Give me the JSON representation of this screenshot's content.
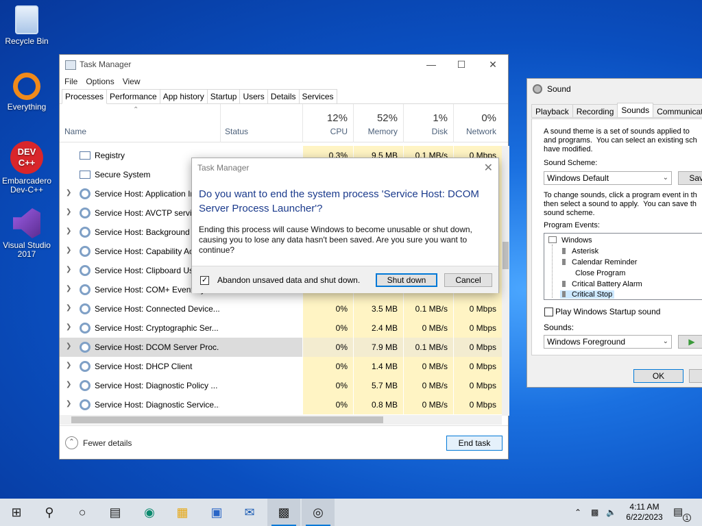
{
  "desktop": {
    "icons": [
      {
        "label": "Recycle Bin"
      },
      {
        "label": "Everything"
      },
      {
        "label": "Embarcadero Dev-C++",
        "badge": "DEV C++"
      },
      {
        "label": "Visual Studio 2017"
      }
    ]
  },
  "taskmanager": {
    "title": "Task Manager",
    "menu": [
      "File",
      "Options",
      "View"
    ],
    "tabs": [
      "Processes",
      "Performance",
      "App history",
      "Startup",
      "Users",
      "Details",
      "Services"
    ],
    "columns": {
      "name": "Name",
      "status": "Status",
      "cpu": {
        "pct": "12%",
        "label": "CPU"
      },
      "memory": {
        "pct": "52%",
        "label": "Memory"
      },
      "disk": {
        "pct": "1%",
        "label": "Disk"
      },
      "network": {
        "pct": "0%",
        "label": "Network"
      }
    },
    "rows": [
      {
        "name": "Registry",
        "cpu": "0.3%",
        "mem": "9.5 MB",
        "disk": "0.1 MB/s",
        "net": "0 Mbps",
        "expandable": false
      },
      {
        "name": "Secure System",
        "cpu": "",
        "mem": "",
        "disk": "",
        "net": "",
        "expandable": false
      },
      {
        "name": "Service Host: Application Information",
        "cpu": "",
        "mem": "",
        "disk": "",
        "net": "",
        "expandable": true
      },
      {
        "name": "Service Host: AVCTP service",
        "cpu": "",
        "mem": "",
        "disk": "",
        "net": "",
        "expandable": true
      },
      {
        "name": "Service Host: Background Intelligent",
        "cpu": "",
        "mem": "",
        "disk": "",
        "net": "",
        "expandable": true
      },
      {
        "name": "Service Host: Capability Access",
        "cpu": "",
        "mem": "",
        "disk": "",
        "net": "",
        "expandable": true
      },
      {
        "name": "Service Host: Clipboard User",
        "cpu": "",
        "mem": "",
        "disk": "",
        "net": "",
        "expandable": true
      },
      {
        "name": "Service Host: COM+ Event System",
        "cpu": "",
        "mem": "",
        "disk": "",
        "net": "",
        "expandable": true
      },
      {
        "name": "Service Host: Connected Device...",
        "cpu": "0%",
        "mem": "3.5 MB",
        "disk": "0.1 MB/s",
        "net": "0 Mbps",
        "expandable": true
      },
      {
        "name": "Service Host: Cryptographic Ser...",
        "cpu": "0%",
        "mem": "2.4 MB",
        "disk": "0 MB/s",
        "net": "0 Mbps",
        "expandable": true
      },
      {
        "name": "Service Host: DCOM Server Proc...",
        "cpu": "0%",
        "mem": "7.9 MB",
        "disk": "0.1 MB/s",
        "net": "0 Mbps",
        "expandable": true,
        "selected": true
      },
      {
        "name": "Service Host: DHCP Client",
        "cpu": "0%",
        "mem": "1.4 MB",
        "disk": "0 MB/s",
        "net": "0 Mbps",
        "expandable": true
      },
      {
        "name": "Service Host: Diagnostic Policy ...",
        "cpu": "0%",
        "mem": "5.7 MB",
        "disk": "0 MB/s",
        "net": "0 Mbps",
        "expandable": true
      },
      {
        "name": "Service Host: Diagnostic Service...",
        "cpu": "0%",
        "mem": "0.8 MB",
        "disk": "0 MB/s",
        "net": "0 Mbps",
        "expandable": true
      }
    ],
    "fewer_details": "Fewer details",
    "end_task": "End task"
  },
  "dialog": {
    "title": "Task Manager",
    "instruction": "Do you want to end the system process 'Service Host: DCOM Server Process Launcher'?",
    "content": "Ending this process will cause Windows to become unusable or shut down, causing you to lose any data hasn't been saved. Are you sure you want to continue?",
    "checkbox_label": "Abandon unsaved data and shut down.",
    "checkbox_checked": true,
    "shutdown_label": "Shut down",
    "cancel_label": "Cancel"
  },
  "sound": {
    "title": "Sound",
    "tabs": [
      "Playback",
      "Recording",
      "Sounds",
      "Communications"
    ],
    "intro": "A sound theme is a set of sounds applied to\nand programs.  You can select an existing sch\nhave modified.",
    "scheme_label": "Sound Scheme:",
    "scheme_value": "Windows Default",
    "save_label": "Save",
    "change_text": "To change sounds, click a program event in th\nthen select a sound to apply.  You can save th\nsound scheme.",
    "events_label": "Program Events:",
    "tree_root": "Windows",
    "events": [
      "Asterisk",
      "Calendar Reminder",
      "Close Program",
      "Critical Battery Alarm",
      "Critical Stop"
    ],
    "startup_label": "Play Windows Startup sound",
    "sounds_label": "Sounds:",
    "sounds_value": "Windows Foreground",
    "ok_label": "OK"
  },
  "taskbar": {
    "time": "4:11 AM",
    "date": "6/22/2023",
    "notification_count": "1"
  }
}
